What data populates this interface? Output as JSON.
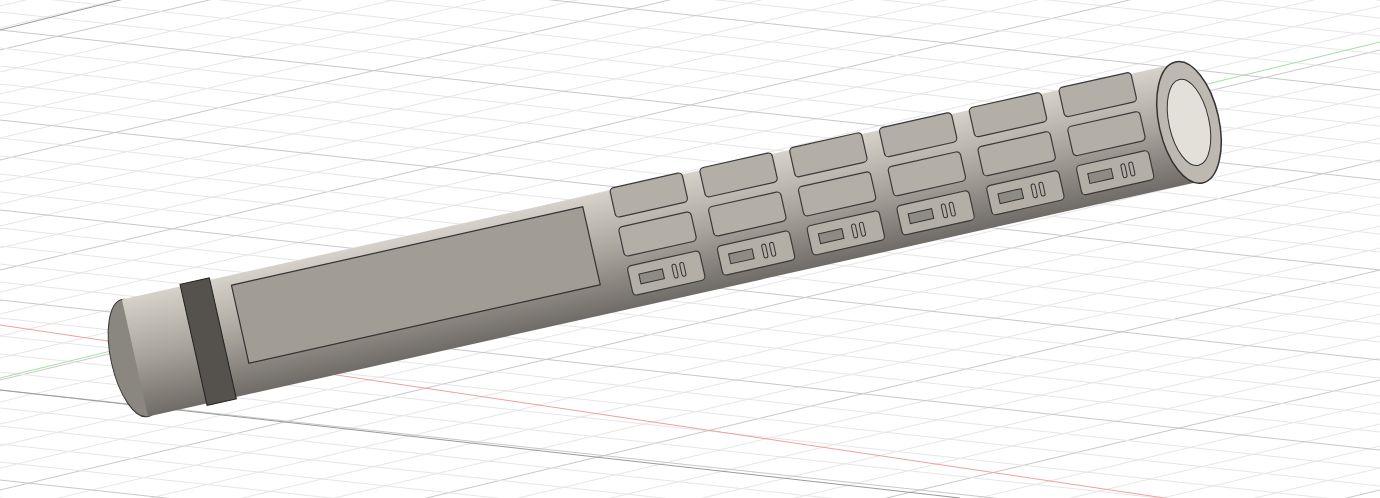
{
  "viewport": {
    "kind": "cad-3d-view"
  }
}
